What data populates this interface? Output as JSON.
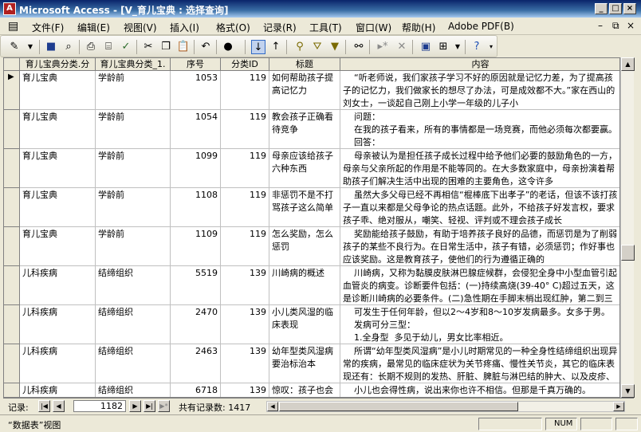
{
  "window": {
    "title": "Microsoft Access - [V_育儿宝典 : 选择查询]",
    "app_icon_label": "A"
  },
  "menubar": {
    "items": [
      "文件(F)",
      "编辑(E)",
      "视图(V)",
      "插入(I)",
      "格式(O)",
      "记录(R)",
      "工具(T)",
      "窗口(W)",
      "帮助(H)",
      "Adobe PDF(B)"
    ]
  },
  "datasheet": {
    "columns": [
      "育儿宝典分类.分",
      "育儿宝典分类_1.",
      "序号",
      "分类ID",
      "标题",
      "内容"
    ],
    "rows": [
      {
        "c1": "育儿宝典",
        "c2": "学龄前",
        "seq": "1053",
        "catid": "119",
        "title": "如何帮助孩子提高记忆力",
        "content": "    “听老师说，我们家孩子学习不好的原因就是记忆力差，为了提高孩子的记忆力，我们做家长的想尽了办法，可是成效都不大。”家在西山的刘女士，一谈起自己刚上小学一年级的儿子小"
      },
      {
        "c1": "育儿宝典",
        "c2": "学龄前",
        "seq": "1054",
        "catid": "119",
        "title": "教会孩子正确看待竞争",
        "content": "    问题：\n    在我的孩子看来，所有的事情都是一场竞赛，而他必须每次都要赢。\n    回答："
      },
      {
        "c1": "育儿宝典",
        "c2": "学龄前",
        "seq": "1099",
        "catid": "119",
        "title": "母亲应该给孩子六种东西",
        "content": "    母亲被认为是担任孩子成长过程中给予他们必要的鼓励角色的一方，母亲与父亲所起的作用是不能等同的。在大多数家庭中，母亲扮演着帮助孩子们解决生活中出现的困难的主要角色，这令许多"
      },
      {
        "c1": "育儿宝典",
        "c2": "学龄前",
        "seq": "1108",
        "catid": "119",
        "title": "非惩罚不是不打骂孩子这么简单",
        "content": "    虽然大多父母已经不再相信“棍棒底下出孝子”的老话，但该不该打孩子一直以来都是父母争论的热点话题。此外，不给孩子好发言权，要求孩子乖、绝对服从，嘲笑、轻视、评判或不理会孩子成长"
      },
      {
        "c1": "育儿宝典",
        "c2": "学龄前",
        "seq": "1109",
        "catid": "119",
        "title": "怎么奖励，怎么惩罚",
        "content": "    奖励能给孩子鼓励，有助于培养孩子良好的品德，而惩罚是为了削弱孩子的某些不良行为。在日常生活中，孩子有错，必须惩罚；作好事也应该奖励。这是教育孩子，使他们的行为遵循正确的"
      },
      {
        "c1": "儿科疾病",
        "c2": "结缔组织",
        "seq": "5519",
        "catid": "139",
        "title": "川崎病的概述",
        "content": "    川崎病，又称为黏膜皮肤淋巴腺症候群，会侵犯全身中小型血管引起血管炎的病变。诊断要件包括：(一)持续高烧(39-40° C)超过五天，这是诊断川崎病的必要条件。(二)急性期在手脚末梢出现红肿，第二到三周可以在指端看到皮肤脱皮；(三)四肢或躯干出现红疹；"
      },
      {
        "c1": "儿科疾病",
        "c2": "结缔组织",
        "seq": "2470",
        "catid": "139",
        "title": "小儿类风湿的临床表现",
        "content": "    可发生于任何年龄，但以2～4岁和8～10岁发病最多。女多于男。\n    发病可分三型：\n    1.全身型  多见于幼儿，男女比率相近。"
      },
      {
        "c1": "儿科疾病",
        "c2": "结缔组织",
        "seq": "2463",
        "catid": "139",
        "title": "幼年型类风湿病要治标治本",
        "content": "    所谓“幼年型类风湿病”是小儿时期常见的一种全身性结缔组织出现异常的疾病，最常见的临床症状为关节疼痛、慢性关节炎，其它的临床表现还有：长期不规则的发热、肝脏、脾脏与淋巴结的肿大、以及皮疹、心包炎等等。"
      },
      {
        "c1": "儿科疾病",
        "c2": "结缔组织",
        "seq": "6718",
        "catid": "139",
        "title": "惊叹：孩子也会",
        "content": "    小儿也会得性病，说出来你也许不相信。但那是千真万确的。"
      }
    ]
  },
  "navigation": {
    "label": "记录:",
    "current_record": "1182",
    "total_label": "共有记录数: 1417"
  },
  "statusbar": {
    "view_label": "“数据表”视图",
    "num_indicator": "NUM"
  }
}
